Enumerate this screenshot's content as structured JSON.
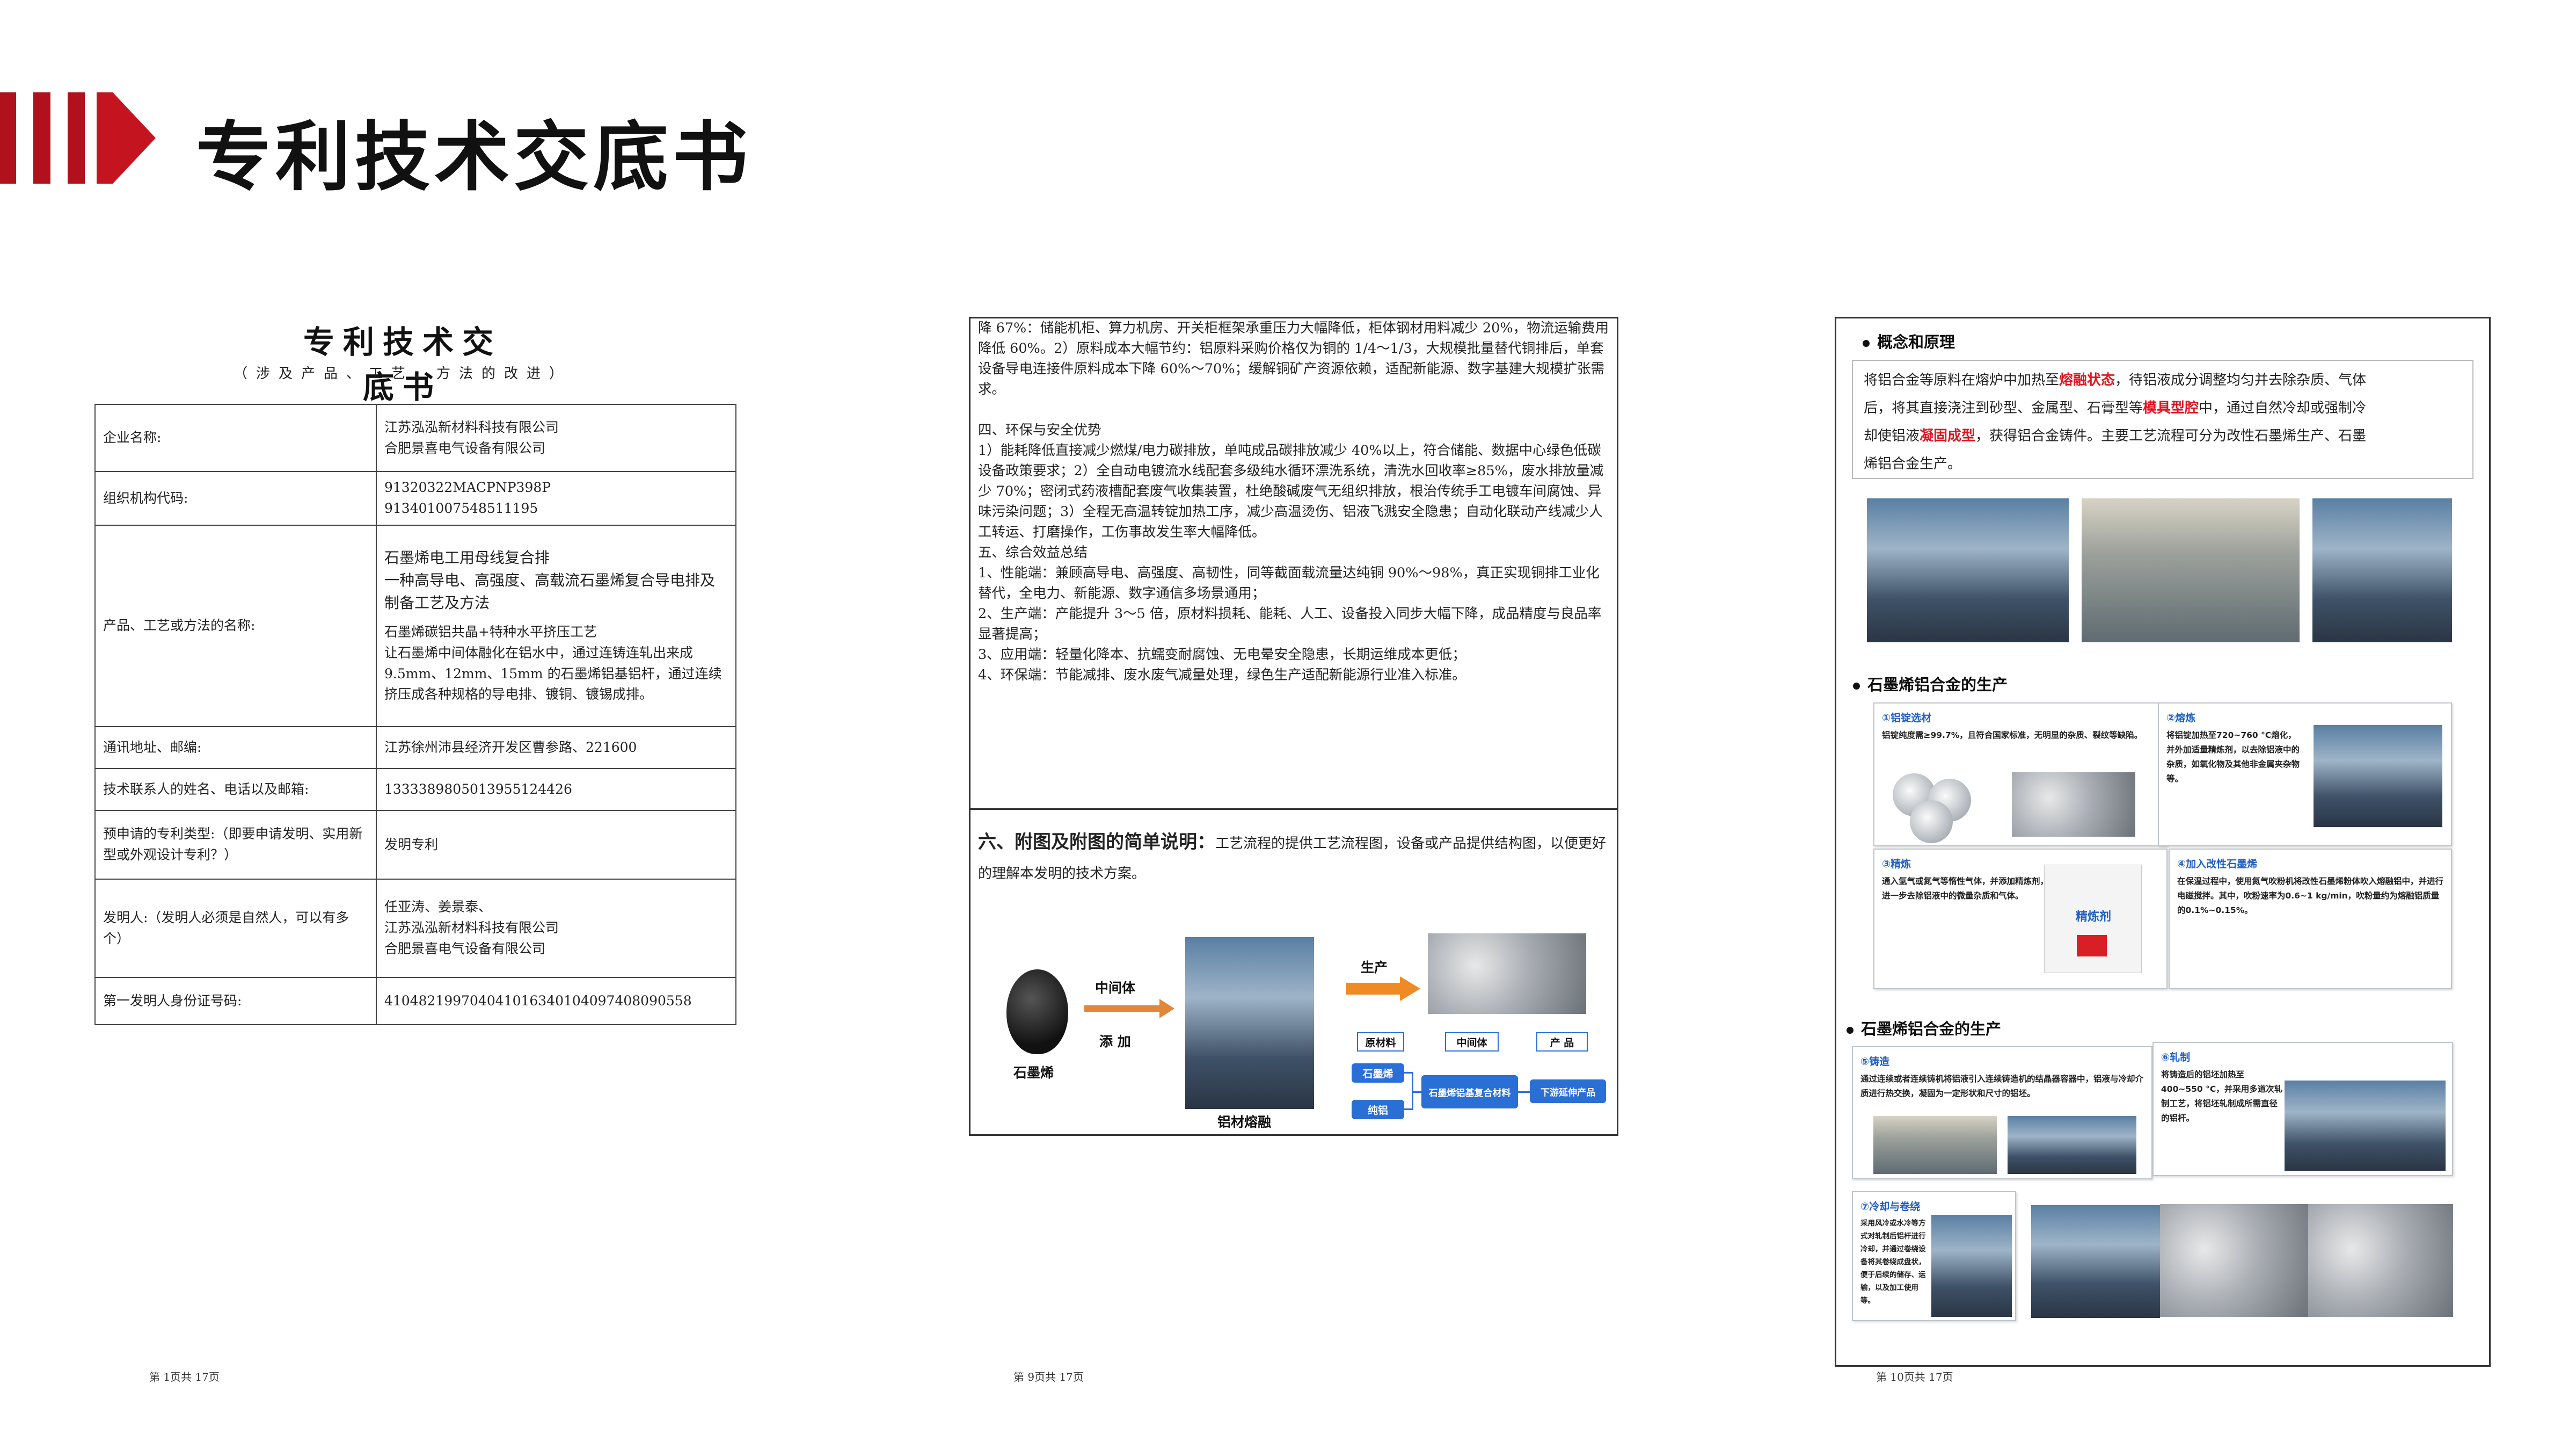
{
  "header": {
    "title": "专利技术交底书"
  },
  "page1": {
    "title": "专利技术交底书",
    "subtitle": "（涉及产品、工艺、方法的改进）",
    "rows": [
      {
        "label": "企业名称:",
        "value_lines": [
          "江苏泓泓新材料科技有限公司",
          "合肥景喜电气设备有限公司"
        ]
      },
      {
        "label": "组织机构代码:",
        "value_lines": [
          "91320322MACPNP398P",
          "913401007548511195"
        ]
      },
      {
        "label": "产品、工艺或方法的名称:",
        "value_lines": [
          "石墨烯电工用母线复合排",
          "一种高导电、高强度、高载流石墨烯复合导电排及制备工艺及方法",
          "石墨烯碳铝共晶+特种水平挤压工艺",
          "让石墨烯中间体融化在铝水中，通过连铸连轧出来成 9.5mm、12mm、15mm 的石墨烯铝基铝杆，通过连续挤压成各种规格的导电排、镀铜、镀锡成排。"
        ]
      },
      {
        "label": "通讯地址、邮编:",
        "value_lines": [
          "江苏徐州沛县经济开发区曹参路、221600"
        ]
      },
      {
        "label": "技术联系人的姓名、电话以及邮箱:",
        "value_lines": [
          "133338980501395512442​6"
        ]
      },
      {
        "label": "预申请的专利类型:（即要申请发明、实用新型或外观设计专利？）",
        "value_lines": [
          "发明专利"
        ]
      },
      {
        "label": "发明人:（发明人必须是自然人，可以有多个）",
        "value_lines": [
          "任亚涛、姜景泰、",
          "江苏泓泓新材料科技有限公司",
          "合肥景喜电气设备有限公司"
        ]
      },
      {
        "label": "第一发明人身份证号码:",
        "value_lines": [
          "41048219970404101634010409740809055​8"
        ]
      }
    ],
    "footer": "第 1页共 17页"
  },
  "page9": {
    "paragraphs": [
      "降 67%：储能机柜、算力机房、开关柜框架承重压力大幅降低，柜体钢材用料减少 20%，物流运输费用降低 60%。2）原料成本大幅节约：铝原料采购价格仅为铜的 1/4～1/3，大规模批量替代铜排后，单套设备导电连接件原料成本下降 60%～70%；缓解铜矿产资源依赖，适配新能源、数字基建大规模扩张需求。",
      "",
      "四、环保与安全优势",
      "1）能耗降低直接减少燃煤/电力碳排放，单吨成品碳排放减少 40%以上，符合储能、数据中心绿色低碳设备政策要求；2）全自动电镀流水线配套多级纯水循环漂洗系统，清洗水回收率≥85%，废水排放量减少 70%；密闭式药液槽配套废气收集装置，杜绝酸碱废气无组织排放，根治传统手工电镀车间腐蚀、异味污染问题；3）全程无高温转锭加热工序，减少高温烫伤、铝液飞溅安全隐患；自动化联动产线减少人工转运、打磨操作，工伤事故发生率大幅降低。",
      "五、综合效益总结",
      "1、性能端：兼顾高导电、高强度、高韧性，同等截面载流量达纯铜 90%～98%，真正实现铜排工业化替代，全电力、新能源、数字通信多场景通用；",
      "2、生产端：产能提升 3～5 倍，原材料损耗、能耗、人工、设备投入同步大幅下降，成品精度与良品率显著提高；",
      "3、应用端：轻量化降本、抗蠕变耐腐蚀、无电晕安全隐患，长期运维成本更低；",
      "4、环保端：节能减排、废水废气减量处理，绿色生产适配新能源行业准入标准。"
    ],
    "section6_heading": "六、附图及附图的简单说明：",
    "section6_text": "工艺流程的提供工艺流程图，设备或产品提供结构图，以便更好的理解本发明的技术方案。",
    "diagram": {
      "graphene": "石墨烯",
      "intermediate": "中间体",
      "add": "添 加",
      "melt": "铝材熔融",
      "produce": "生产",
      "row_labels": [
        "原材料",
        "中间体",
        "产 品"
      ],
      "nodes": [
        "石墨烯",
        "纯铝",
        "石墨烯铝基复合材料",
        "下游延伸产品"
      ]
    },
    "footer": "第 9页共 17页"
  },
  "page10": {
    "concept_heading": "概念和原理",
    "concept_lines": [
      [
        "将铝合金等原料在熔炉中加热至",
        "熔融状态",
        "，待铝液成分调整均匀并去除杂质、气体"
      ],
      [
        "后，将其直接浇注到砂型、金属型、石膏型等",
        "模具型腔",
        "中，通过自然冷却或强制冷"
      ],
      [
        "却使铝液",
        "凝固成型",
        "，获得铝合金铸件。主要工艺流程可分为改性石墨烯生产、石墨"
      ],
      [
        "烯铝合金生产。",
        "",
        ""
      ]
    ],
    "section2_heading": "石墨烯铝合金的生产",
    "cards_a": [
      {
        "title": "①铝锭选材",
        "text": "铝锭纯度需≥99.7%，且符合国家标准，无明显的杂质、裂纹等缺陷。"
      },
      {
        "title": "②熔炼",
        "text": "将铝锭加热至720~760 °C熔化，并外加适量精炼剂，以去除铝液中的杂质，如氧化物及其他非金属夹杂物等。"
      },
      {
        "title": "③精炼",
        "text": "通入氩气或氮气等惰性气体，并添加精炼剂，进一步去除铝液中的微量杂质和气体。"
      },
      {
        "title": "④加入改性石墨烯",
        "text": "在保温过程中，使用氮气吹粉机将改性石墨烯粉体吹入熔融铝中，并进行电磁搅拌。其中，吹粉速率为0.6~1 kg/min，吹粉量约为熔融铝质量的0.1%~0.15%。"
      }
    ],
    "bag_text": "精炼剂",
    "section3_heading": "石墨烯铝合金的生产",
    "cards_b": [
      {
        "title": "⑤铸造",
        "text": "通过连续或者连续铸机将铝液引入连续铸造机的结晶器容器中，铝液与冷却介质进行热交换，凝固为一定形状和尺寸的铝坯。"
      },
      {
        "title": "⑥轧制",
        "text": "将铸造后的铝坯加热至400~550 °C，并采用多道次轧制工艺，将铝坯轧制成所需直径的铝杆。"
      },
      {
        "title": "⑦冷却与卷绕",
        "text": "采用风冷或水冷等方式对轧制后铝杆进行冷却，并通过卷绕设备将其卷绕成盘状，便于后续的储存、运输，以及加工使用等。"
      }
    ],
    "footer": "第 10页共 17页"
  },
  "colors": {
    "brand_red": "#b0111c",
    "highlight_red": "#e0161e",
    "flow_blue": "#2a6fd6",
    "card_title_blue": "#1f5fc4"
  }
}
